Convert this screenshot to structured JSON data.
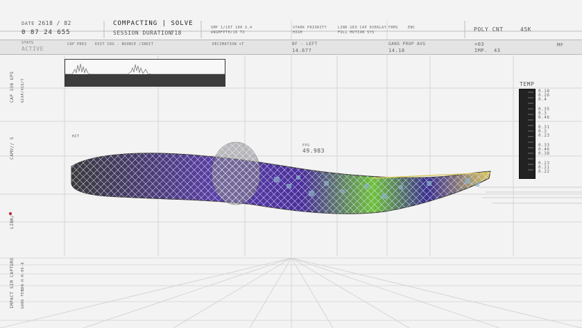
{
  "header": {
    "date_label": "DATE",
    "date_value": "2618 / 82",
    "timecode": "0 87 24 655",
    "mode": "COMPACTING | SOLVE",
    "session_label": "SESSION DURATION",
    "session_value": "718",
    "mid_info_1a": "SMP 1/16T 100 X.4",
    "mid_info_1b": "ANGMFPTH/16 TX",
    "mid_info_2a": "STARK PRIORITY",
    "mid_info_2b": "HIGH",
    "mid_info_3a": "LINK GEO CAP OVERLAY",
    "mid_info_3b": "FULL MOTION SYS",
    "frame_label": "FRMS",
    "frame_value": "ENC",
    "poly_label": "POLY CNT",
    "poly_value": "45K"
  },
  "band": {
    "status_label": "STATS",
    "status_value": "ACTIVE",
    "cap_press": "CAP PRES",
    "exit_info": "EXIT CRG - BOUNCE /INDIT",
    "decimation": "DECIMATION +T",
    "bf_label": "BF - LEFT",
    "bf_value": "14.677",
    "gans_label": "GANS PROP AVG",
    "gans_value": "14.18",
    "delta_label": "+03",
    "imp_label": "IMP.",
    "imp_value": "43",
    "mf_label": "MF"
  },
  "side": {
    "cap_label": "CAP 336 UPS",
    "cap_sub": "GCAP/416/T",
    "camv_label": "CAMV// 5",
    "link_label": "LINK/",
    "code_label": "S-N-H-R-05-8",
    "impact_label": "IMPACT SIM CAPTURE",
    "gans_feed": "GANS FEED"
  },
  "view": {
    "hit_label": "HIT",
    "fps_label": "FPS",
    "fps_value": "49.983"
  },
  "temp": {
    "title": "TEMP",
    "values": [
      "0.18",
      "0.26",
      "0.4",
      "0.35",
      "0.3",
      "0.46",
      "0.31",
      "0.3",
      "0.23",
      "0.33",
      "0.46",
      "0.38",
      "0.23",
      "0.21",
      "0.22"
    ]
  },
  "colors": {
    "background": "#f3f3f3",
    "panel_dark": "#222222",
    "mesh_purple": "#5a3fa8",
    "mesh_green": "#6fc23a",
    "accent_red": "#c0202a"
  }
}
